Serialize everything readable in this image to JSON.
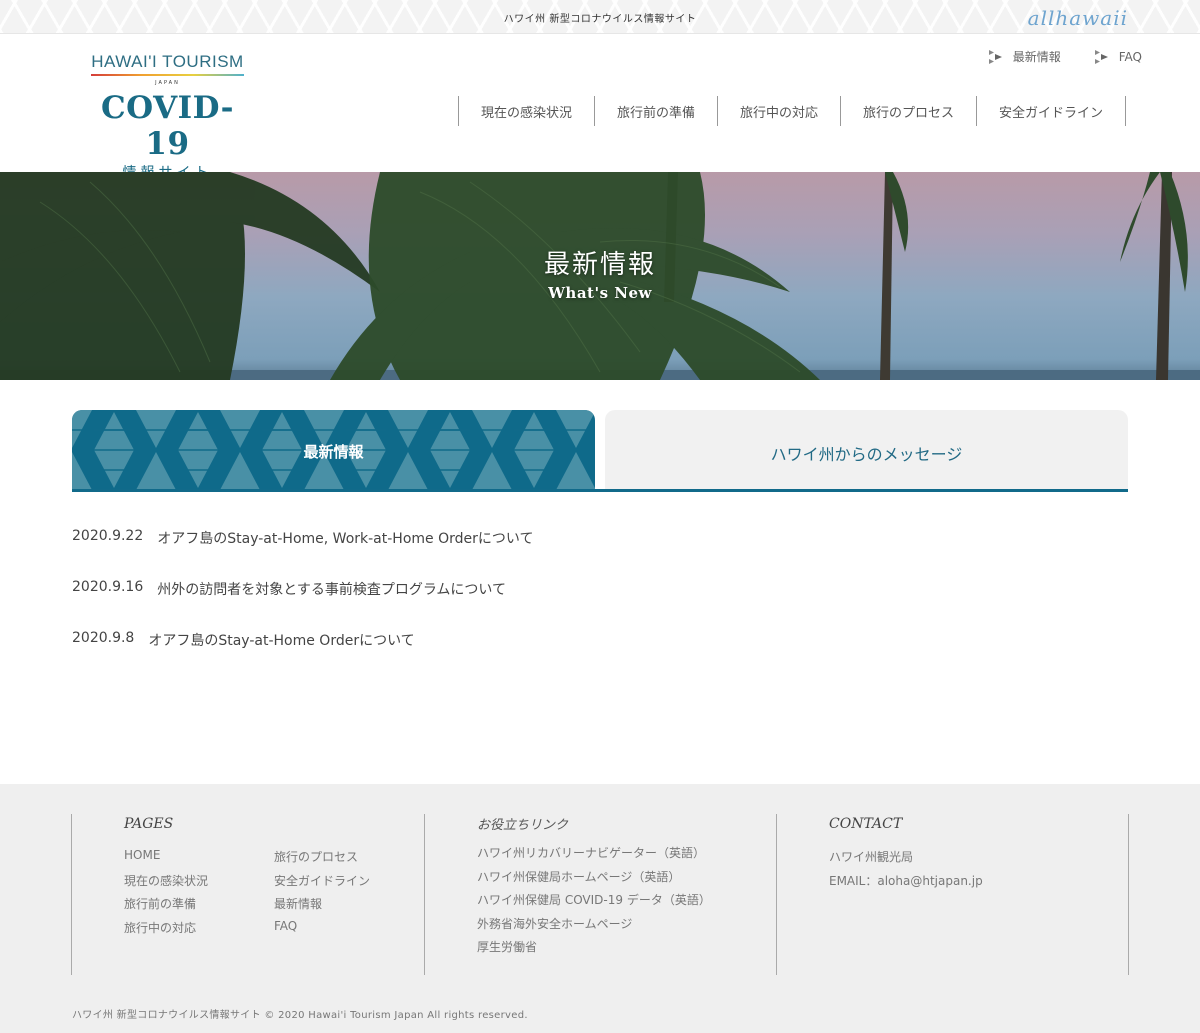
{
  "topbar": {
    "site_title": "ハワイ州 新型コロナウイルス情報サイト",
    "brand_script": "allhawaii"
  },
  "logo": {
    "org": "HAWAI'I TOURISM",
    "region": "JAPAN",
    "title": "COVID-19",
    "subtitle": "情報サイト"
  },
  "util_nav": [
    {
      "label": "最新情報",
      "icon": "play-arrow-icon"
    },
    {
      "label": "FAQ",
      "icon": "play-arrow-icon"
    }
  ],
  "main_nav": [
    {
      "label": "現在の感染状況"
    },
    {
      "label": "旅行前の準備"
    },
    {
      "label": "旅行中の対応"
    },
    {
      "label": "旅行のプロセス"
    },
    {
      "label": "安全ガイドライン"
    }
  ],
  "hero": {
    "title": "最新情報",
    "subtitle": "What's New"
  },
  "tabs": [
    {
      "label": "最新情報",
      "active": true
    },
    {
      "label": "ハワイ州からのメッセージ",
      "active": false
    }
  ],
  "news": [
    {
      "date": "2020.9.22",
      "title": "オアフ島のStay-at-Home, Work-at-Home Orderについて"
    },
    {
      "date": "2020.9.16",
      "title": "州外の訪問者を対象とする事前検査プログラムについて"
    },
    {
      "date": "2020.9.8",
      "title": "オアフ島のStay-at-Home Orderについて"
    }
  ],
  "footer": {
    "pages": {
      "heading": "PAGES",
      "col1": [
        "HOME",
        "現在の感染状況",
        "旅行前の準備",
        "旅行中の対応"
      ],
      "col2": [
        "旅行のプロセス",
        "安全ガイドライン",
        "最新情報",
        "FAQ"
      ]
    },
    "links": {
      "heading": "お役立ちリンク",
      "items": [
        "ハワイ州リカバリーナビゲーター（英語）",
        "ハワイ州保健局ホームページ（英語）",
        "ハワイ州保健局 COVID-19 データ（英語）",
        "外務省海外安全ホームページ",
        "厚生労働省"
      ]
    },
    "contact": {
      "heading": "CONTACT",
      "org": "ハワイ州観光局",
      "email": "EMAIL：aloha@htjapan.jp"
    },
    "copyright": "ハワイ州 新型コロナウイルス情報サイト © 2020 Hawai'i Tourism Japan All rights reserved."
  },
  "colors": {
    "brand_teal": "#1a6b85",
    "tab_active_bg": "#0f6a8a",
    "tab_inactive_bg": "#f1f1f1",
    "footer_bg": "#efefef"
  }
}
